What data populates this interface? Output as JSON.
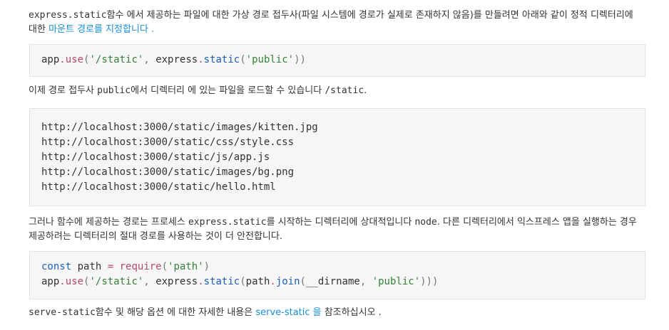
{
  "paragraph1": {
    "code": "express.static",
    "text": "함수 에서 제공하는 파일에 대한 가상 경로 접두사(파일 시스템에 경로가 실제로 존재하지 않음)를 만들려면 아래와 같이 정적 디렉터리에",
    "line2_prefix": "대한 ",
    "link": "마운트 경로를 지정합니다 ."
  },
  "code1": {
    "line1": {
      "app": "app",
      "dot1": ".",
      "use": "use",
      "open": "(",
      "str1": "'/static'",
      "comma": ", ",
      "express": "express",
      "dot2": ".",
      "static": "static",
      "open2": "(",
      "str2": "'public'",
      "close": "))"
    }
  },
  "paragraph2": {
    "part1": "이제 경로 접두사 ",
    "code1": "public",
    "part2": "에서 디렉터리 에 있는 파일을 로드할 수 있습니다 ",
    "code2": "/static",
    "part3": "."
  },
  "code2": {
    "lines": [
      "http://localhost:3000/static/images/kitten.jpg",
      "http://localhost:3000/static/css/style.css",
      "http://localhost:3000/static/js/app.js",
      "http://localhost:3000/static/images/bg.png",
      "http://localhost:3000/static/hello.html"
    ]
  },
  "paragraph3": {
    "part1": "그러나 함수에 제공하는 경로는 프로세스 ",
    "code1": "express.static",
    "part2": "를 시작하는 디렉터리에 상대적입니다 ",
    "code2": "node",
    "part3": ". 다른 디렉터리에서 익스프레스 앱을 실행하는 경우",
    "line2": "제공하려는 디렉터리의 절대 경로를 사용하는 것이 더 안전합니다."
  },
  "code3": {
    "line1": {
      "const": "const",
      "sp1": " path ",
      "eq": "=",
      "sp2": " ",
      "require": "require",
      "open": "(",
      "str": "'path'",
      "close": ")"
    },
    "line2": {
      "app": "app",
      "dot1": ".",
      "use": "use",
      "open": "(",
      "str1": "'/static'",
      "comma": ", ",
      "express": "express",
      "dot2": ".",
      "static": "static",
      "open2": "(",
      "path": "path",
      "dot3": ".",
      "join": "join",
      "open3": "(",
      "dirname": "__dirname",
      "comma2": ", ",
      "str2": "'public'",
      "close": ")))"
    }
  },
  "paragraph4": {
    "code": "serve-static",
    "part1": "함수 및 해당 옵션 에 대한 자세한 내용은 ",
    "link": "serve-static 을",
    "part2": " 참조하십시오 ."
  }
}
